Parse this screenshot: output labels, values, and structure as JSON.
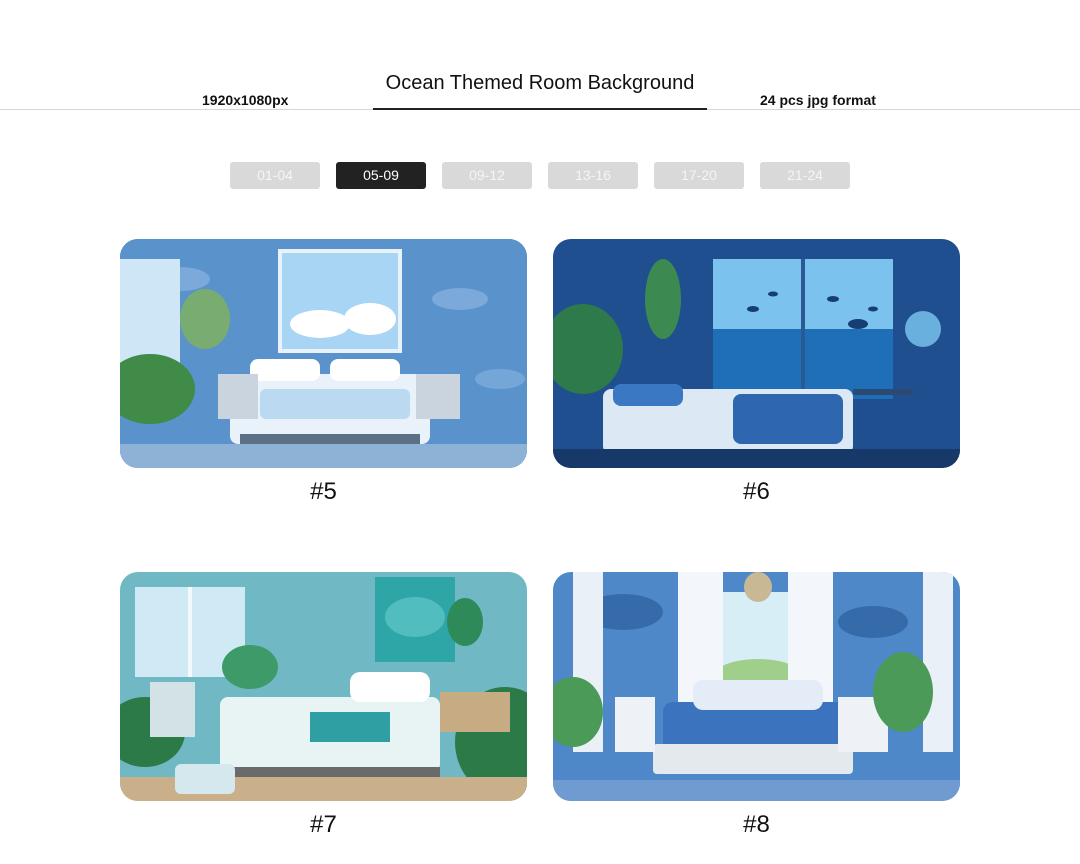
{
  "header": {
    "left_text": "1920x1080px",
    "title": "Ocean Themed Room Background",
    "right_text": "24 pcs jpg format"
  },
  "tabs": [
    {
      "label": "01-04",
      "active": false
    },
    {
      "label": "05-09",
      "active": true
    },
    {
      "label": "09-12",
      "active": false
    },
    {
      "label": "13-16",
      "active": false
    },
    {
      "label": "17-20",
      "active": false
    },
    {
      "label": "21-24",
      "active": false
    }
  ],
  "gallery": [
    {
      "caption": "#5",
      "scene": "bedroom with window, blue leaf wallpaper, white bed"
    },
    {
      "caption": "#6",
      "scene": "bedroom with aquarium ocean window and fish"
    },
    {
      "caption": "#7",
      "scene": "teal bedroom with plants and ocean painting"
    },
    {
      "caption": "#8",
      "scene": "bright bedroom with white curtains and blue bedding"
    }
  ]
}
